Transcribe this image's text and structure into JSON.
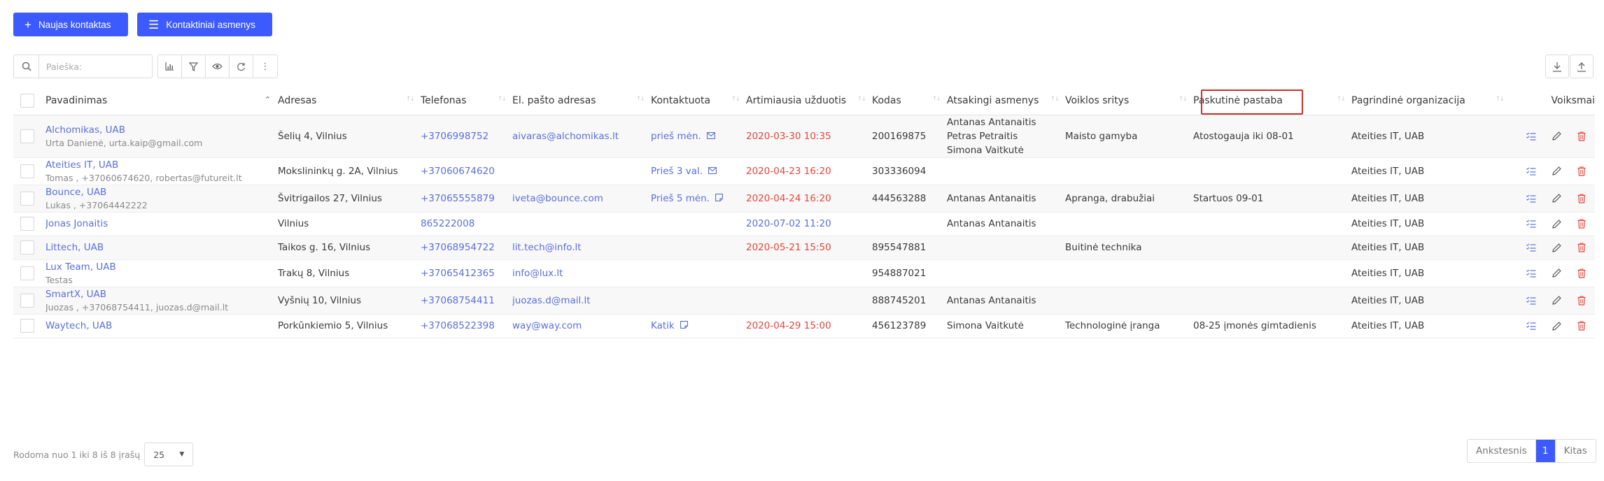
{
  "actions": {
    "new_contact": "Naujas kontaktas",
    "contact_persons": "Kontaktiniai asmenys"
  },
  "search": {
    "placeholder": "Paieška:"
  },
  "columns": {
    "name": "Pavadinimas",
    "address": "Adresas",
    "phone": "Telefonas",
    "email": "El. pašto adresas",
    "contacted": "Kontaktuota",
    "nearest_task": "Artimiausia užduotis",
    "code": "Kodas",
    "responsible": "Atsakingi asmenys",
    "field": "Voiklos sritys",
    "last_note": "Paskutinė pastaba",
    "main_org": "Pagrindinė organizacija",
    "actions": "Voiksmai"
  },
  "rows": [
    {
      "name": "Alchomikas, UAB",
      "sub": "Urta Danienė, urta.kaip@gmail.com",
      "address": "Šelių 4, Vilnius",
      "phone": "+3706998752",
      "email": "aivaras@alchomikas.lt",
      "contacted": "prieš mėn.",
      "contacted_icon": "mail-icon",
      "task": "2020-03-30 10:35",
      "task_color": "red",
      "code": "200169875",
      "responsible": [
        "Antanas Antanaitis",
        "Petras Petraitis",
        "Simona Vaitkutė"
      ],
      "field": "Maisto gamyba",
      "note": "Atostogauja iki 08-01",
      "org": "Ateities IT, UAB"
    },
    {
      "name": "Ateities IT, UAB",
      "sub": "Tomas , +37060674620, robertas@futureit.lt",
      "address": "Mokslininkų g. 2A, Vilnius",
      "phone": "+37060674620",
      "email": "",
      "contacted": "Prieš 3 val.",
      "contacted_icon": "mail-icon",
      "task": "2020-04-23 16:20",
      "task_color": "red",
      "code": "303336094",
      "responsible": [],
      "field": "",
      "note": "",
      "org": "Ateities IT, UAB"
    },
    {
      "name": "Bounce, UAB",
      "sub": "Lukas , +37064442222",
      "address": "Švitrigailos 27, Vilnius",
      "phone": "+37065555879",
      "email": "iveta@bounce.com",
      "contacted": "Prieš 5 mėn.",
      "contacted_icon": "note-icon",
      "task": "2020-04-24 16:20",
      "task_color": "red",
      "code": "444563288",
      "responsible": [
        "Antanas Antanaitis"
      ],
      "field": "Apranga, drabužiai",
      "note": "Startuos 09-01",
      "org": "Ateities IT, UAB"
    },
    {
      "name": "Jonas Jonaitis",
      "sub": "",
      "address": "Vilnius",
      "phone": "865222008",
      "email": "",
      "contacted": "",
      "contacted_icon": "",
      "task": "2020-07-02 11:20",
      "task_color": "blue",
      "code": "",
      "responsible": [
        "Antanas Antanaitis"
      ],
      "field": "",
      "note": "",
      "org": "Ateities IT, UAB"
    },
    {
      "name": "Littech, UAB",
      "sub": "",
      "address": "Taikos g. 16, Vilnius",
      "phone": "+37068954722",
      "email": "lit.tech@info.lt",
      "contacted": "",
      "contacted_icon": "",
      "task": "2020-05-21 15:50",
      "task_color": "red",
      "code": "895547881",
      "responsible": [],
      "field": "Buitinė technika",
      "note": "",
      "org": "Ateities IT, UAB"
    },
    {
      "name": "Lux Team, UAB",
      "sub": "Testas",
      "address": "Trakų 8, Vilnius",
      "phone": "+37065412365",
      "email": "info@lux.lt",
      "contacted": "",
      "contacted_icon": "",
      "task": "",
      "task_color": "",
      "code": "954887021",
      "responsible": [],
      "field": "",
      "note": "",
      "org": "Ateities IT, UAB"
    },
    {
      "name": "SmartX, UAB",
      "sub": "Juozas , +37068754411, juozas.d@mail.lt",
      "address": "Vyšnių 10, Vilnius",
      "phone": "+37068754411",
      "email": "juozas.d@mail.lt",
      "contacted": "",
      "contacted_icon": "",
      "task": "",
      "task_color": "",
      "code": "888745201",
      "responsible": [
        "Antanas Antanaitis"
      ],
      "field": "",
      "note": "",
      "org": "Ateities IT, UAB"
    },
    {
      "name": "Waytech, UAB",
      "sub": "",
      "address": "Porkūnkiemio 5, Vilnius",
      "phone": "+37068522398",
      "email": "way@way.com",
      "contacted": "Katik",
      "contacted_icon": "note-icon",
      "task": "2020-04-29 15:00",
      "task_color": "red",
      "code": "456123789",
      "responsible": [
        "Simona Vaitkutė"
      ],
      "field": "Technologinė įranga",
      "note": "08-25 įmonės gimtadienis",
      "org": "Ateities IT, UAB"
    }
  ],
  "footer": {
    "info": "Rodoma nuo 1 iki 8 iš 8 įrašų",
    "page_size": "25",
    "prev": "Ankstesnis",
    "current_page": "1",
    "next": "Kitas"
  },
  "colors": {
    "primary": "#3d5afe",
    "link": "#5a6fd9",
    "danger": "#e8453c",
    "highlight": "#d32a2a"
  }
}
